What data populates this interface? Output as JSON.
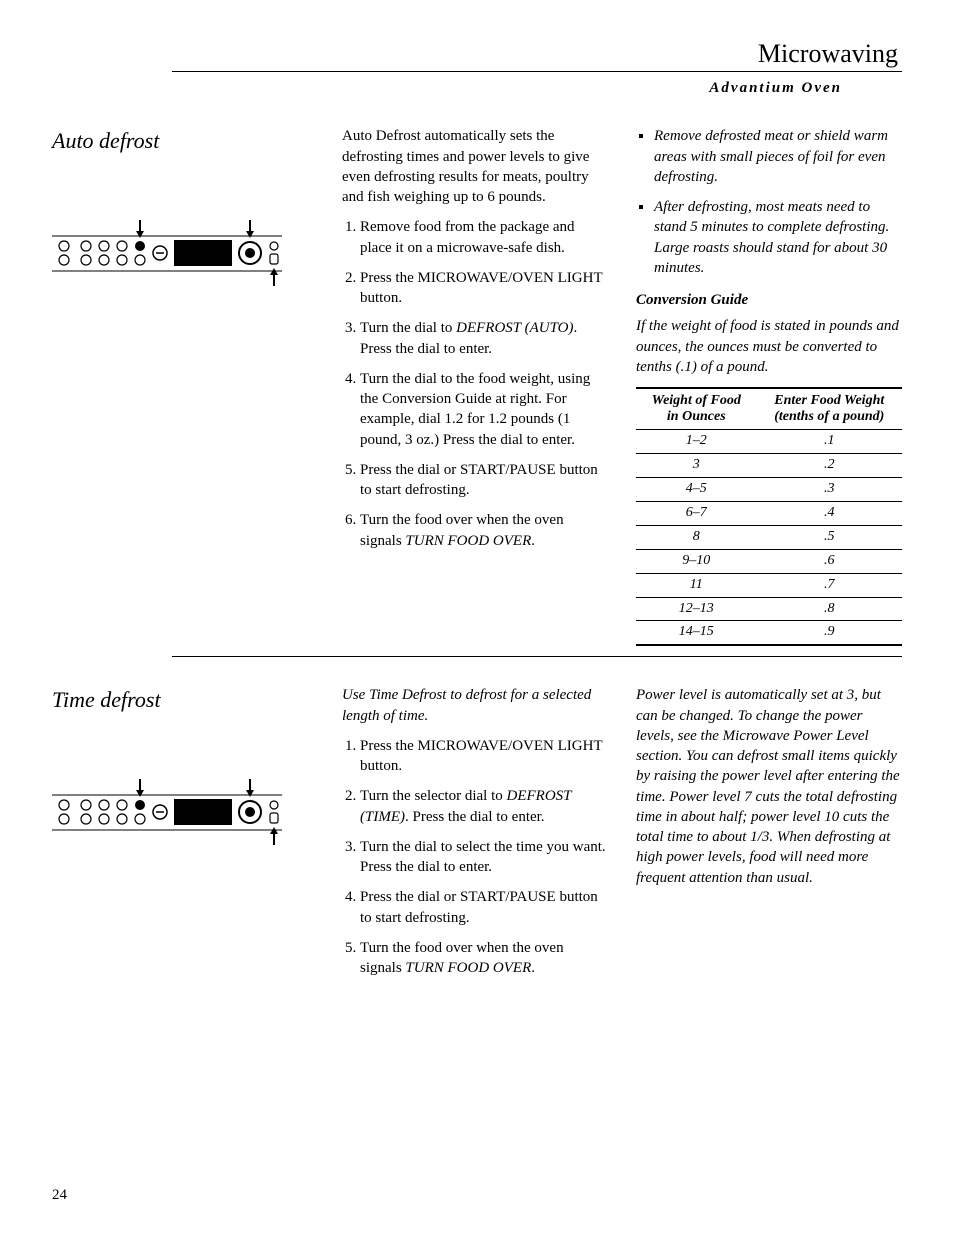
{
  "header": {
    "title": "Microwaving",
    "subtitle": "Advantium Oven"
  },
  "section1": {
    "heading": "Auto defrost",
    "intro": "Auto Defrost automatically sets the defrosting times and power levels to give even defrosting results for meats, poultry and fish weighing up to 6 pounds.",
    "steps": [
      "Remove food from the package and place it on a microwave-safe dish.",
      "Press the MICROWAVE/OVEN LIGHT button.",
      "Turn the dial to <span class='italic'>DEFROST (AUTO)</span>. Press the dial to enter.",
      "Turn the dial to the food weight, using the Conversion Guide at right. For example, dial 1.2 for 1.2 pounds (1 pound, 3 oz.) Press the dial to enter.",
      "Press the dial or START/PAUSE button to start defrosting.",
      "Turn the food over when the oven signals <span class='italic'>TURN FOOD OVER</span>."
    ],
    "bullets": [
      "Remove defrosted meat or shield warm areas with small pieces of foil for even defrosting.",
      "After defrosting, most meats need to stand 5 minutes to complete defrosting. Large roasts should stand for about 30 minutes."
    ],
    "conv_heading": "Conversion Guide",
    "conv_intro": "If the weight of food is stated in pounds and ounces, the ounces must be converted to tenths (.1) of a pound.",
    "table_h1a": "Weight of Food",
    "table_h1b": "in Ounces",
    "table_h2a": "Enter Food Weight",
    "table_h2b": "(tenths of a pound)",
    "table": [
      {
        "oz": "1–2",
        "t": ".1"
      },
      {
        "oz": "3",
        "t": ".2"
      },
      {
        "oz": "4–5",
        "t": ".3"
      },
      {
        "oz": "6–7",
        "t": ".4"
      },
      {
        "oz": "8",
        "t": ".5"
      },
      {
        "oz": "9–10",
        "t": ".6"
      },
      {
        "oz": "11",
        "t": ".7"
      },
      {
        "oz": "12–13",
        "t": ".8"
      },
      {
        "oz": "14–15",
        "t": ".9"
      }
    ]
  },
  "section2": {
    "heading": "Time defrost",
    "intro": "Use Time Defrost to defrost for a selected length of time.",
    "steps": [
      "Press the MICROWAVE/OVEN LIGHT button.",
      "Turn the selector dial to <span class='italic'>DEFROST (TIME)</span>. Press the dial to enter.",
      "Turn the dial to select the time you want. Press the dial to enter.",
      "Press the dial or START/PAUSE button to start defrosting.",
      "Turn the food over when the oven signals <span class='italic'>TURN FOOD OVER</span>."
    ],
    "right_para": "Power level is automatically set at 3, but can be changed. To change the power levels, see the Microwave Power Level section. You can defrost small items quickly by raising the power level after entering the time. Power level 7 cuts the total defrosting time in about half; power level 10 cuts the total time to about 1/3. When defrosting at high power levels, food will need more frequent attention than usual."
  },
  "page_number": "24"
}
